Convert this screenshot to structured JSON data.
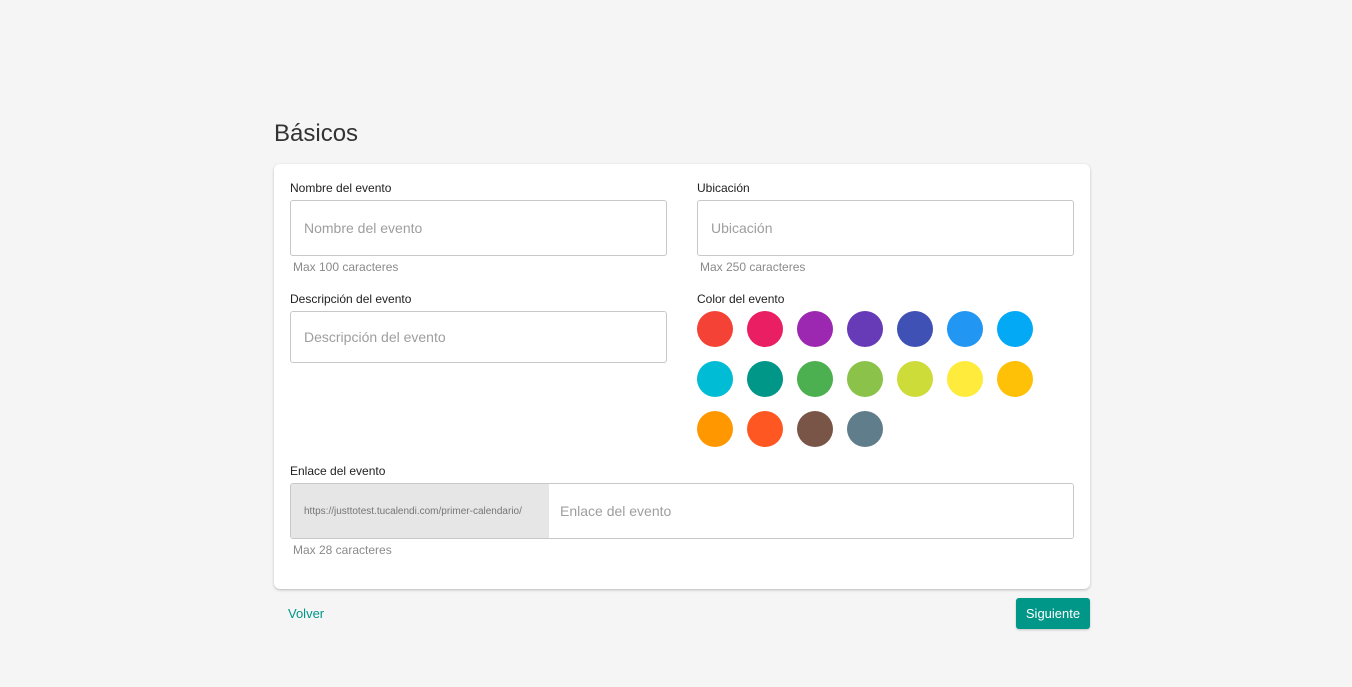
{
  "page": {
    "title": "Básicos"
  },
  "form": {
    "event_name": {
      "label": "Nombre del evento",
      "placeholder": "Nombre del evento",
      "value": "",
      "hint": "Max 100 caracteres"
    },
    "location": {
      "label": "Ubicación",
      "placeholder": "Ubicación",
      "value": "",
      "hint": "Max 250 caracteres"
    },
    "description": {
      "label": "Descripción del evento",
      "placeholder": "Descripción del evento",
      "value": ""
    },
    "color": {
      "label": "Color del evento",
      "options": [
        "#f44336",
        "#e91e63",
        "#9c27b0",
        "#673ab7",
        "#3f51b5",
        "#2196f3",
        "#03a9f4",
        "#00bcd4",
        "#009688",
        "#4caf50",
        "#8bc34a",
        "#cddc39",
        "#ffeb3b",
        "#ffc107",
        "#ff9800",
        "#ff5722",
        "#795548",
        "#607d8b"
      ]
    },
    "link": {
      "label": "Enlace del evento",
      "prefix": "https://justtotest.tucalendi.com/primer-calendario/",
      "placeholder": "Enlace del evento",
      "value": "",
      "hint": "Max 28 caracteres"
    }
  },
  "actions": {
    "back_label": "Volver",
    "next_label": "Siguiente"
  },
  "theme": {
    "accent": "#009688",
    "background": "#f5f5f5"
  }
}
